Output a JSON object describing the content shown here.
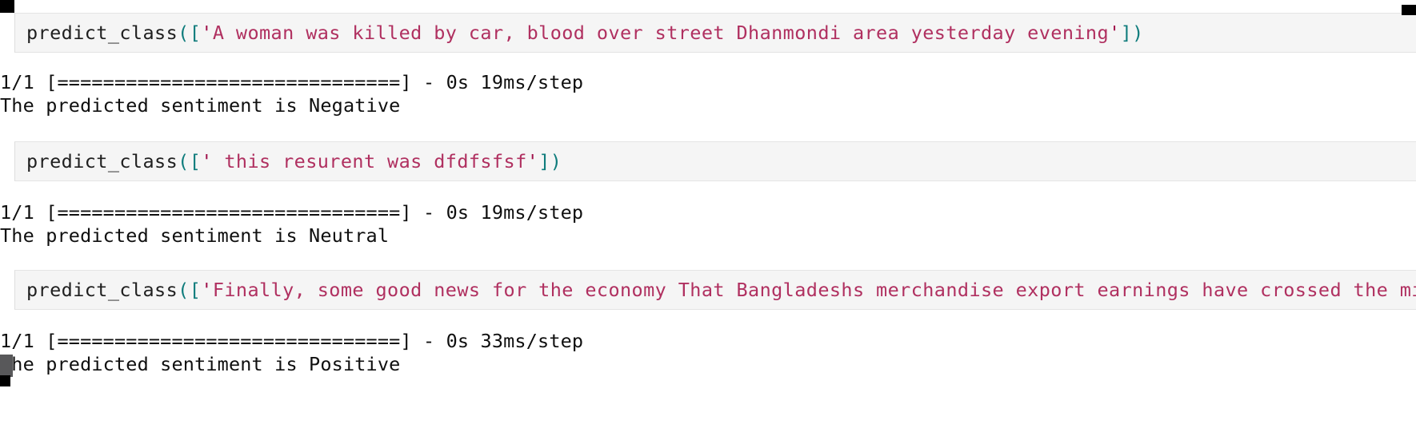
{
  "app": {
    "type": "jupyter-notebook-output",
    "background": "#ffffff",
    "cell_background": "#f5f5f5",
    "cell_border": "#e4e4e4"
  },
  "colors": {
    "identifier": "#1f1f1f",
    "punctuation": "#0f7c7c",
    "string": "#b03060",
    "string_literal": "#a0104a",
    "output_text": "#0f0f0f"
  },
  "cells": [
    {
      "id": "cell-1",
      "code": {
        "function": "predict_class",
        "open": "([",
        "quote_open": "'",
        "string": "A woman was killed by car, blood over street Dhanmondi area yesterday evening",
        "quote_close": "'",
        "close": "])"
      },
      "output": {
        "progress": "1/1 [==============================] - 0s 19ms/step",
        "result": "The predicted sentiment is Negative",
        "sentiment": "Negative",
        "steps": "1/1",
        "elapsed": "0s",
        "per_step": "19ms/step"
      }
    },
    {
      "id": "cell-2",
      "code": {
        "function": "predict_class",
        "open": "([",
        "quote_open": "'",
        "string": " this resurent was dfdfsfsf",
        "quote_close": "'",
        "close": "])"
      },
      "output": {
        "progress": "1/1 [==============================] - 0s 19ms/step",
        "result": "The predicted sentiment is Neutral",
        "sentiment": "Neutral",
        "steps": "1/1",
        "elapsed": "0s",
        "per_step": "19ms/step"
      }
    },
    {
      "id": "cell-3",
      "code": {
        "function": "predict_class",
        "open": "([",
        "quote_open": "'",
        "string": "Finally, some good news for the economy That Bangladeshs merchandise export earnings have crossed the mil",
        "quote_close": "",
        "close": "",
        "clipped": true
      },
      "output": {
        "progress": "1/1 [==============================] - 0s 33ms/step",
        "result": "The predicted sentiment is Positive",
        "sentiment": "Positive",
        "steps": "1/1",
        "elapsed": "0s",
        "per_step": "33ms/step"
      }
    }
  ]
}
